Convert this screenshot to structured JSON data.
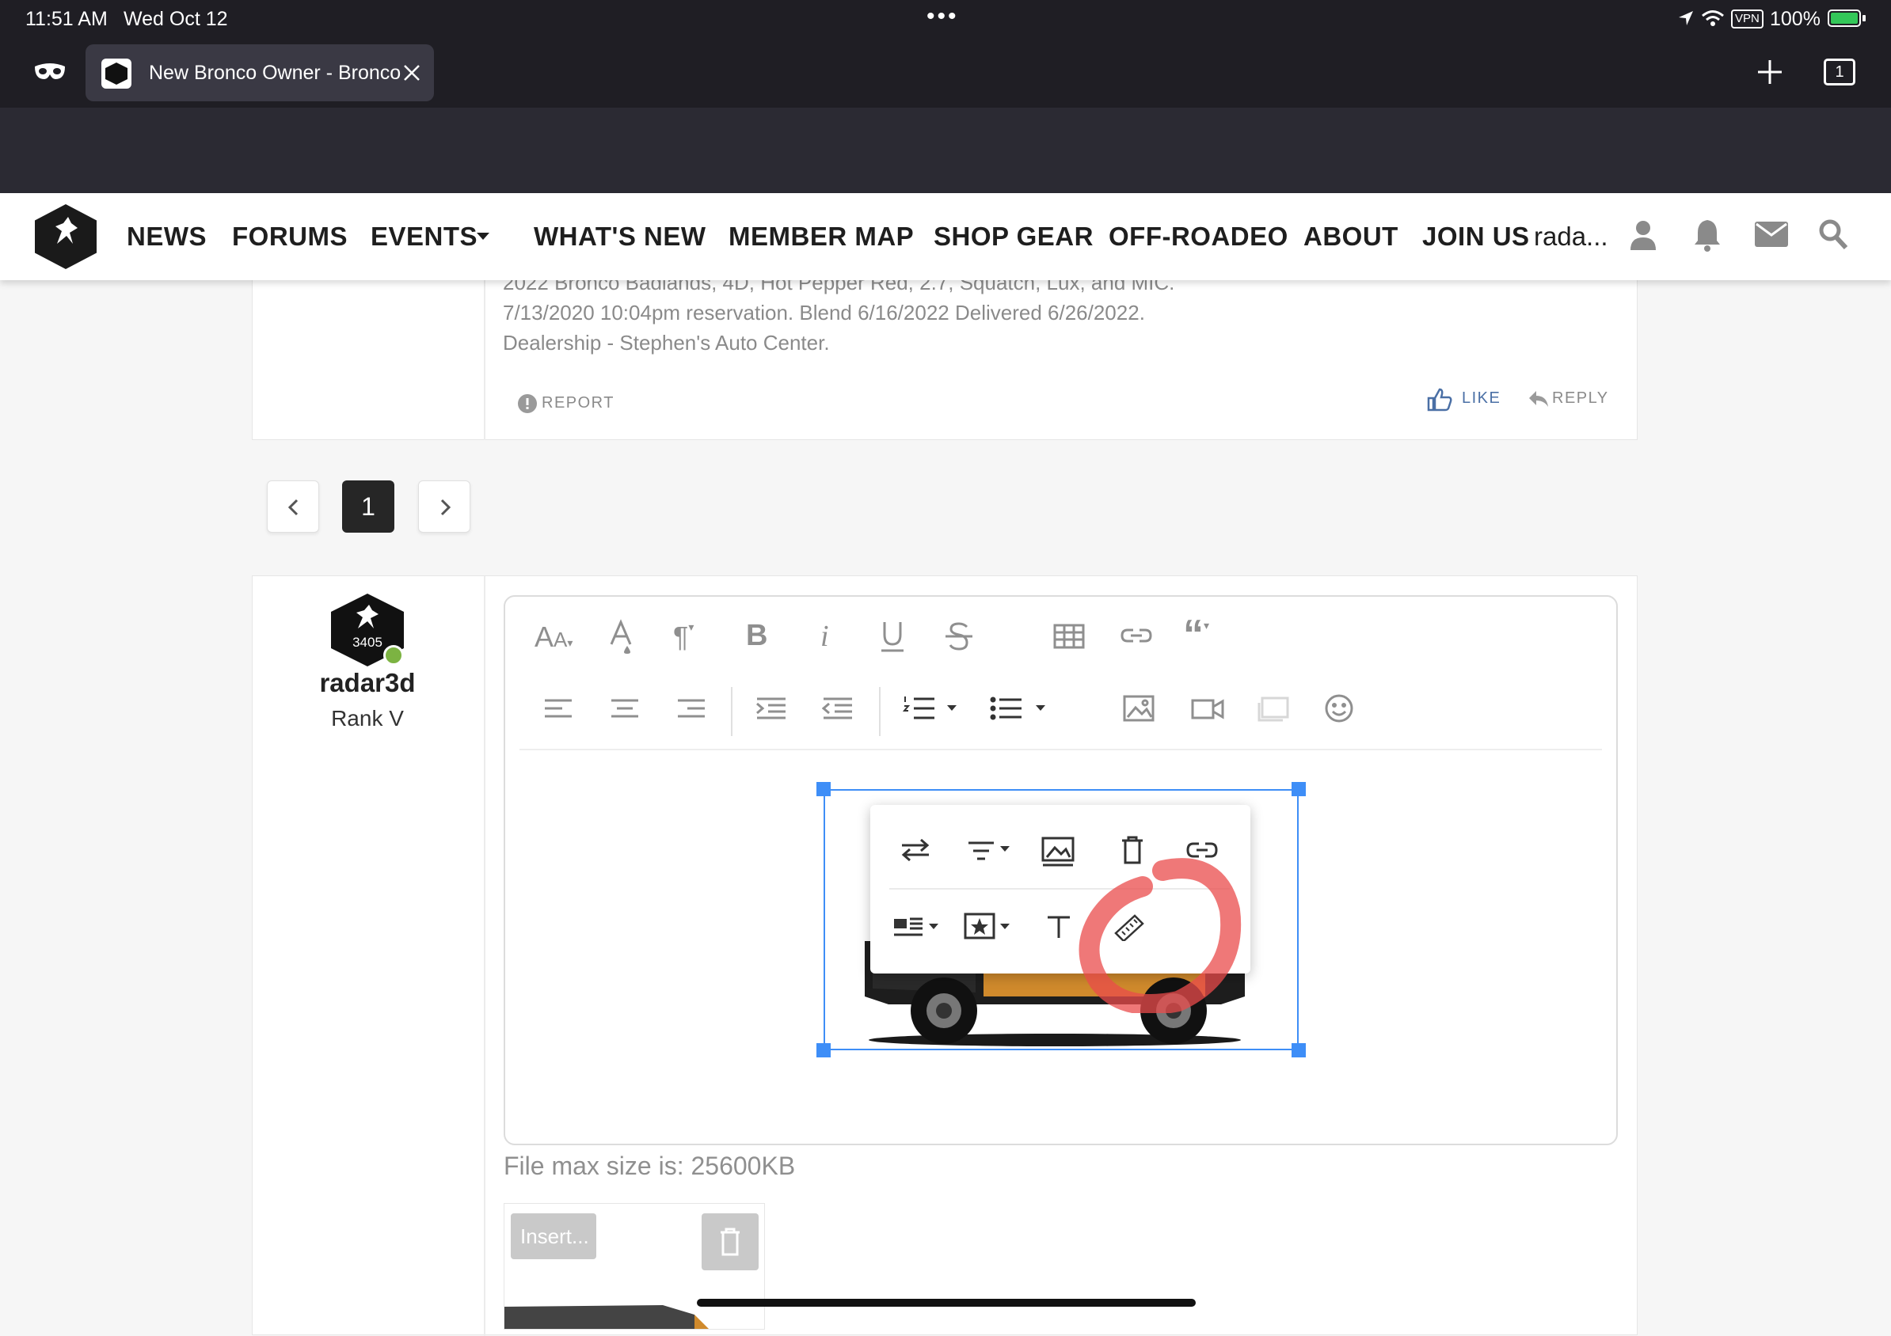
{
  "status_bar": {
    "time": "11:51 AM",
    "date": "Wed Oct 12",
    "vpn": "VPN",
    "battery": "100%"
  },
  "browser": {
    "tab_title": "New Bronco Owner - Bronco",
    "tab_count": "1"
  },
  "nav": {
    "items": [
      "NEWS",
      "FORUMS",
      "EVENTS",
      "WHAT'S NEW",
      "MEMBER MAP",
      "SHOP GEAR",
      "OFF-ROADEO",
      "ABOUT",
      "JOIN US"
    ],
    "user_short": "rada..."
  },
  "post": {
    "signature_lines": [
      "2022 Bronco Badlands, 4D, Hot Pepper Red, 2.7, Squatch, Lux, and MIC.",
      "7/13/2020 10:04pm reservation. Blend 6/16/2022 Delivered 6/26/2022.",
      "Dealership - Stephen's Auto Center."
    ],
    "report_label": "REPORT",
    "like_label": "LIKE",
    "reply_label": "REPLY"
  },
  "pagination": {
    "current_page": "1"
  },
  "reply_author": {
    "avatar_number": "3405",
    "username": "radar3d",
    "rank": "Rank V"
  },
  "editor": {
    "file_max_size": "File max size is: 25600KB",
    "insert_label": "Insert..."
  },
  "colors": {
    "accent_blue": "#3e8ef7",
    "online_green": "#7cb342",
    "annotation_red": "#e94b4b",
    "like_blue": "#4a6fa5"
  }
}
